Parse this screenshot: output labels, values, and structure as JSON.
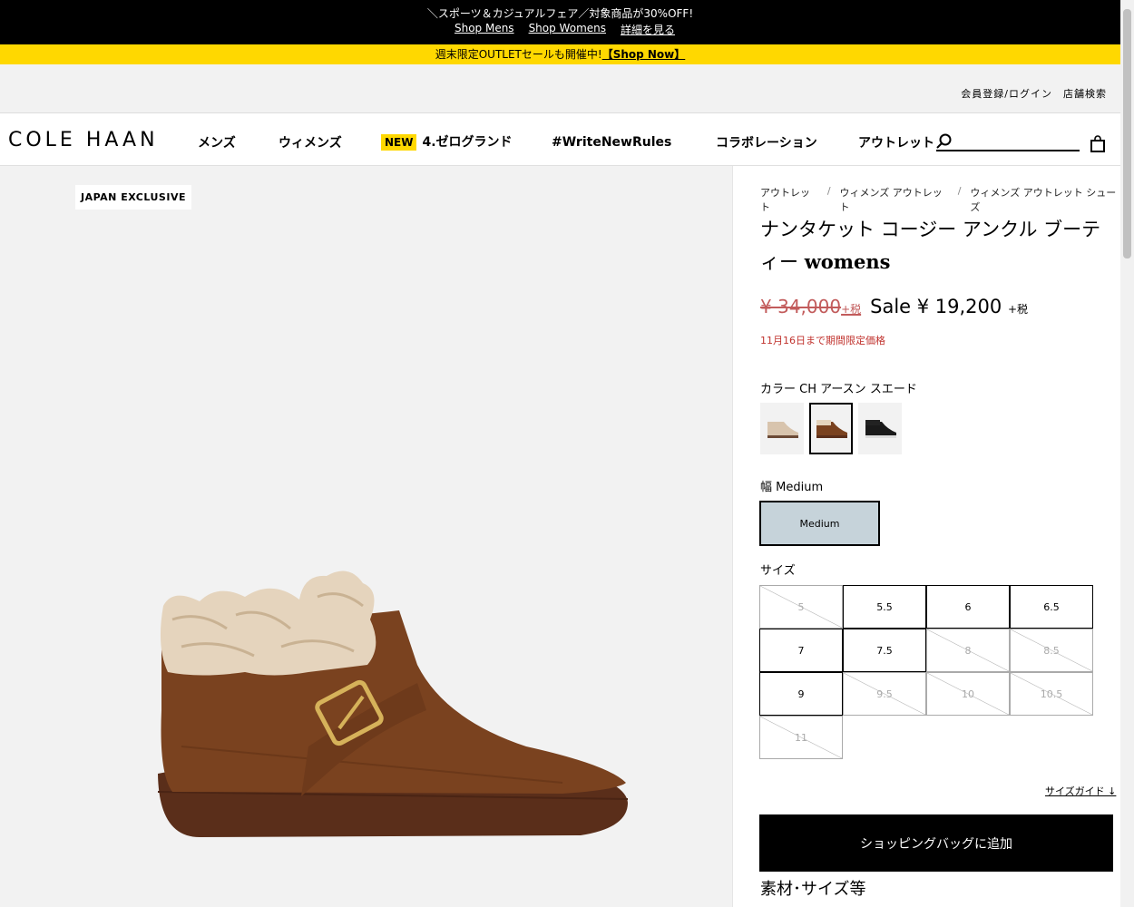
{
  "promo": {
    "line1": "＼スポーツ＆カジュアルフェア／対象商品が30%OFF!",
    "shop_mens": "Shop Mens",
    "shop_womens": "Shop Womens",
    "details": "詳細を見る",
    "weekend": "週末限定OUTLETセールも開催中!",
    "shop_now": "【Shop Now】"
  },
  "util": {
    "login": "会員登録/ログイン",
    "store_search": "店舗検索"
  },
  "nav": {
    "logo": "COLE HAAN",
    "mens": "メンズ",
    "womens": "ウィメンズ",
    "new_badge": "NEW",
    "zerogrand": "4.ゼログランド",
    "write_new_rules": "#WriteNewRules",
    "collab": "コラボレーション",
    "outlet": "アウトレット",
    "search_placeholder": ""
  },
  "gallery": {
    "badge": "JAPAN EXCLUSIVE"
  },
  "product": {
    "breadcrumbs": [
      "アウトレット",
      "ウィメンズ アウトレット",
      "ウィメンズ アウトレット シューズ"
    ],
    "title_jp": "ナンタケット コージー アンクル ブーティー",
    "title_en": "womens",
    "old_price": "¥ 34,000",
    "tax1": "+税",
    "sale_price": "Sale ¥ 19,200",
    "tax2": "+税",
    "limited": "11月16日まで期間限定価格",
    "color_label": "カラー CH アースン スエード",
    "width_label": "幅 Medium",
    "width_option": "Medium",
    "size_label": "サイズ",
    "sizes": [
      {
        "label": "5",
        "available": false
      },
      {
        "label": "5.5",
        "available": true
      },
      {
        "label": "6",
        "available": true
      },
      {
        "label": "6.5",
        "available": true
      },
      {
        "label": "7",
        "available": true
      },
      {
        "label": "7.5",
        "available": true
      },
      {
        "label": "8",
        "available": false
      },
      {
        "label": "8.5",
        "available": false
      },
      {
        "label": "9",
        "available": true
      },
      {
        "label": "9.5",
        "available": false
      },
      {
        "label": "10",
        "available": false
      },
      {
        "label": "10.5",
        "available": false
      },
      {
        "label": "11",
        "available": false
      }
    ],
    "size_guide": "サイズガイド ↓",
    "add_to_bag": "ショッピングバッグに追加",
    "material": "素材･サイズ等"
  },
  "colors": {
    "accent_yellow": "#ffd800",
    "sale_red": "#c0322d",
    "width_selected": "#c6d3da"
  }
}
